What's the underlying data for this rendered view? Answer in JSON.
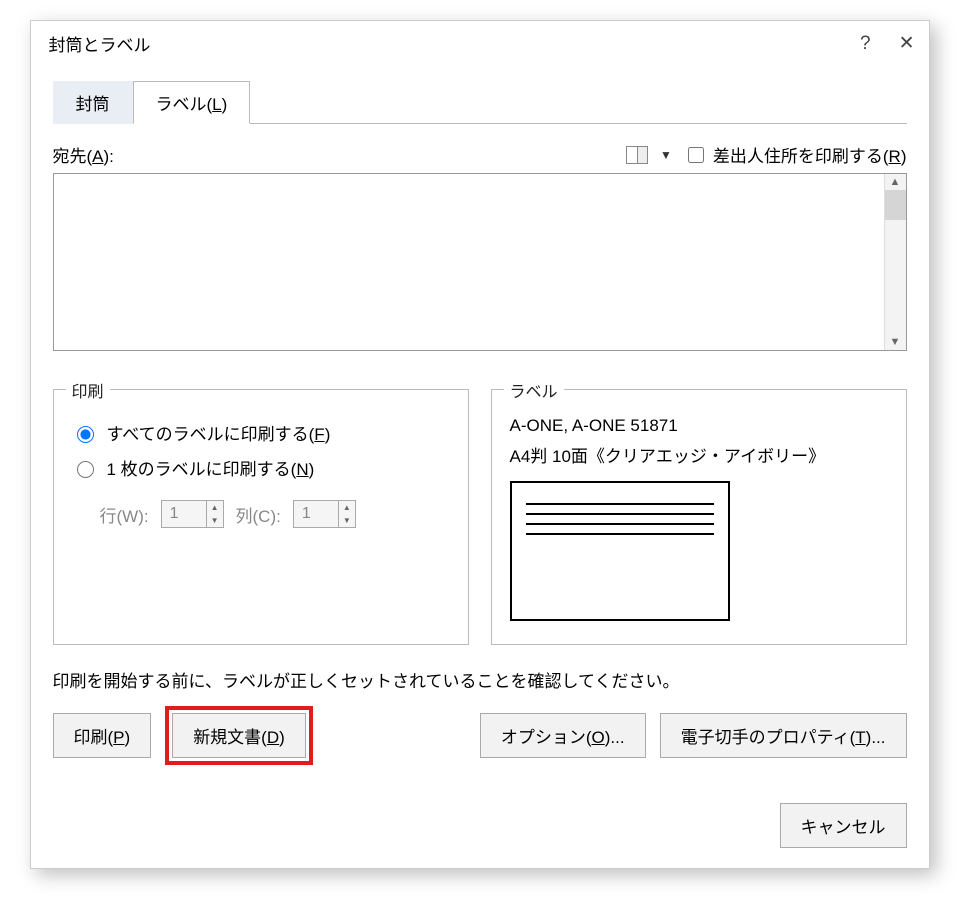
{
  "dialog": {
    "title": "封筒とラベル",
    "help": "?",
    "close": "✕"
  },
  "tabs": {
    "envelope": "封筒",
    "label_prefix": "ラベル(",
    "label_key": "L",
    "label_suffix": ")"
  },
  "address": {
    "label_prefix": "宛先(",
    "label_key": "A",
    "label_suffix": "):",
    "return_prefix": "差出人住所を印刷する(",
    "return_key": "R",
    "return_suffix": ")",
    "value": ""
  },
  "print_group": {
    "title": "印刷",
    "all_prefix": "すべてのラベルに印刷する(",
    "all_key": "F",
    "all_suffix": ")",
    "one_prefix": "1 枚のラベルに印刷する(",
    "one_key": "N",
    "one_suffix": ")",
    "row_label": "行(W):",
    "row_value": "1",
    "col_label": "列(C):",
    "col_value": "1"
  },
  "label_group": {
    "title": "ラベル",
    "line1": "A-ONE, A-ONE 51871",
    "line2": "A4判 10面《クリアエッジ・アイボリー》"
  },
  "hint": "印刷を開始する前に、ラベルが正しくセットされていることを確認してください。",
  "buttons": {
    "print_prefix": "印刷(",
    "print_key": "P",
    "print_suffix": ")",
    "newdoc_prefix": "新規文書(",
    "newdoc_key": "D",
    "newdoc_suffix": ")",
    "options_prefix": "オプション(",
    "options_key": "O",
    "options_suffix": ")...",
    "estamp_prefix": "電子切手のプロパティ(",
    "estamp_key": "T",
    "estamp_suffix": ")...",
    "cancel": "キャンセル"
  }
}
